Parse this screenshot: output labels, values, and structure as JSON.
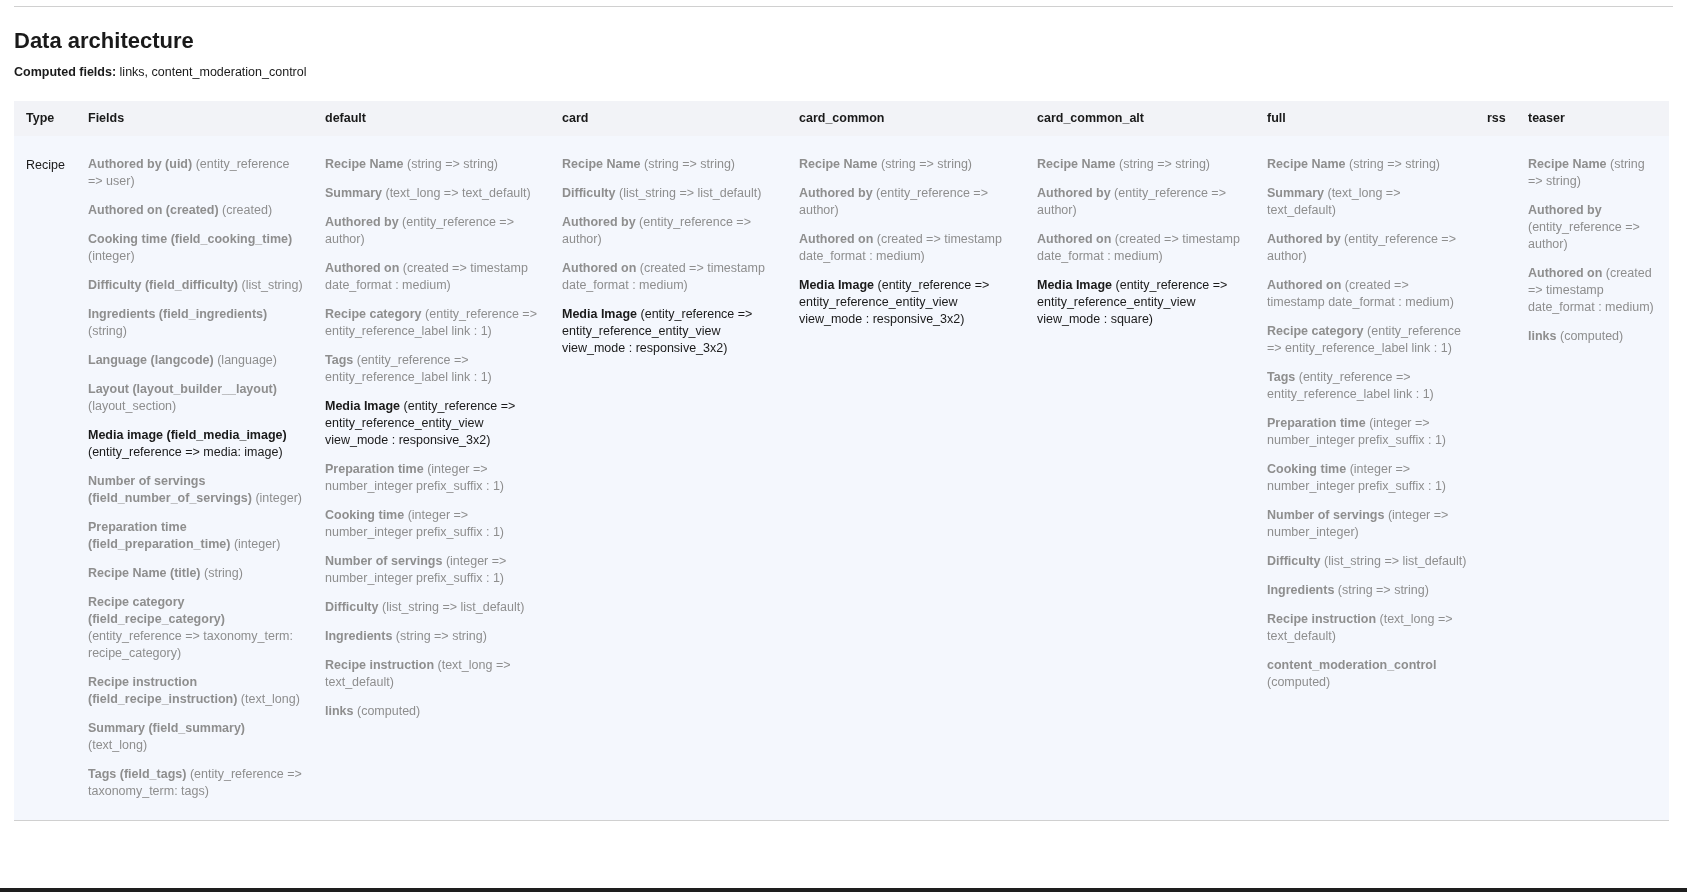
{
  "title": "Data architecture",
  "computed_fields": {
    "label": "Computed fields:",
    "value": "links, content_moderation_control"
  },
  "table": {
    "columns": [
      "Type",
      "Fields",
      "default",
      "card",
      "card_common",
      "card_common_alt",
      "full",
      "rss",
      "teaser"
    ],
    "rows": [
      {
        "cells": [
          {
            "text": "Recipe"
          },
          {
            "items": [
              {
                "label": "Authored by (uid)",
                "detail": "(entity_reference => user)",
                "highlighted": false
              },
              {
                "label": "Authored on (created)",
                "detail": "(created)",
                "highlighted": false
              },
              {
                "label": "Cooking time (field_cooking_time)",
                "detail": "(integer)",
                "highlighted": false
              },
              {
                "label": "Difficulty (field_difficulty)",
                "detail": "(list_string)",
                "highlighted": false
              },
              {
                "label": "Ingredients (field_ingredients)",
                "detail": "(string)",
                "highlighted": false
              },
              {
                "label": "Language (langcode)",
                "detail": "(language)",
                "highlighted": false
              },
              {
                "label": "Layout (layout_builder__layout)",
                "detail": "(layout_section)",
                "highlighted": false
              },
              {
                "label": "Media image (field_media_image)",
                "detail": "(entity_reference => media: image)",
                "highlighted": true
              },
              {
                "label": "Number of servings (field_number_of_servings)",
                "detail": "(integer)",
                "highlighted": false
              },
              {
                "label": "Preparation time (field_preparation_time)",
                "detail": "(integer)",
                "highlighted": false
              },
              {
                "label": "Recipe Name (title)",
                "detail": "(string)",
                "highlighted": false
              },
              {
                "label": "Recipe category (field_recipe_category)",
                "detail": "(entity_reference => taxonomy_term: recipe_category)",
                "highlighted": false
              },
              {
                "label": "Recipe instruction (field_recipe_instruction)",
                "detail": "(text_long)",
                "highlighted": false
              },
              {
                "label": "Summary (field_summary)",
                "detail": "(text_long)",
                "highlighted": false
              },
              {
                "label": "Tags (field_tags)",
                "detail": "(entity_reference => taxonomy_term: tags)",
                "highlighted": false
              }
            ]
          },
          {
            "items": [
              {
                "label": "Recipe Name",
                "detail": "(string => string)",
                "highlighted": false
              },
              {
                "label": "Summary",
                "detail": "(text_long => text_default)",
                "highlighted": false
              },
              {
                "label": "Authored by",
                "detail": "(entity_reference => author)",
                "highlighted": false
              },
              {
                "label": "Authored on",
                "detail": "(created => timestamp date_format : medium)",
                "highlighted": false
              },
              {
                "label": "Recipe category",
                "detail": "(entity_reference => entity_reference_label link : 1)",
                "highlighted": false
              },
              {
                "label": "Tags",
                "detail": "(entity_reference => entity_reference_label link : 1)",
                "highlighted": false
              },
              {
                "label": "Media Image",
                "detail": "(entity_reference => entity_reference_entity_view view_mode : responsive_3x2)",
                "highlighted": true
              },
              {
                "label": "Preparation time",
                "detail": "(integer => number_integer prefix_suffix : 1)",
                "highlighted": false
              },
              {
                "label": "Cooking time",
                "detail": "(integer => number_integer prefix_suffix : 1)",
                "highlighted": false
              },
              {
                "label": "Number of servings",
                "detail": "(integer => number_integer prefix_suffix : 1)",
                "highlighted": false
              },
              {
                "label": "Difficulty",
                "detail": "(list_string => list_default)",
                "highlighted": false
              },
              {
                "label": "Ingredients",
                "detail": "(string => string)",
                "highlighted": false
              },
              {
                "label": "Recipe instruction",
                "detail": "(text_long => text_default)",
                "highlighted": false
              },
              {
                "label": "links",
                "detail": "(computed)",
                "highlighted": false
              }
            ]
          },
          {
            "items": [
              {
                "label": "Recipe Name",
                "detail": "(string => string)",
                "highlighted": false
              },
              {
                "label": "Difficulty",
                "detail": "(list_string => list_default)",
                "highlighted": false
              },
              {
                "label": "Authored by",
                "detail": "(entity_reference => author)",
                "highlighted": false
              },
              {
                "label": "Authored on",
                "detail": "(created => timestamp date_format : medium)",
                "highlighted": false
              },
              {
                "label": "Media Image",
                "detail": "(entity_reference => entity_reference_entity_view view_mode : responsive_3x2)",
                "highlighted": true
              }
            ]
          },
          {
            "items": [
              {
                "label": "Recipe Name",
                "detail": "(string => string)",
                "highlighted": false
              },
              {
                "label": "Authored by",
                "detail": "(entity_reference => author)",
                "highlighted": false
              },
              {
                "label": "Authored on",
                "detail": "(created => timestamp date_format : medium)",
                "highlighted": false
              },
              {
                "label": "Media Image",
                "detail": "(entity_reference => entity_reference_entity_view view_mode : responsive_3x2)",
                "highlighted": true
              }
            ]
          },
          {
            "items": [
              {
                "label": "Recipe Name",
                "detail": "(string => string)",
                "highlighted": false
              },
              {
                "label": "Authored by",
                "detail": "(entity_reference => author)",
                "highlighted": false
              },
              {
                "label": "Authored on",
                "detail": "(created => timestamp date_format : medium)",
                "highlighted": false
              },
              {
                "label": "Media Image",
                "detail": "(entity_reference => entity_reference_entity_view view_mode : square)",
                "highlighted": true
              }
            ]
          },
          {
            "items": [
              {
                "label": "Recipe Name",
                "detail": "(string => string)",
                "highlighted": false
              },
              {
                "label": "Summary",
                "detail": "(text_long => text_default)",
                "highlighted": false
              },
              {
                "label": "Authored by",
                "detail": "(entity_reference => author)",
                "highlighted": false
              },
              {
                "label": "Authored on",
                "detail": "(created => timestamp date_format : medium)",
                "highlighted": false
              },
              {
                "label": "Recipe category",
                "detail": "(entity_reference => entity_reference_label link : 1)",
                "highlighted": false
              },
              {
                "label": "Tags",
                "detail": "(entity_reference => entity_reference_label link : 1)",
                "highlighted": false
              },
              {
                "label": "Preparation time",
                "detail": "(integer => number_integer prefix_suffix : 1)",
                "highlighted": false
              },
              {
                "label": "Cooking time",
                "detail": "(integer => number_integer prefix_suffix : 1)",
                "highlighted": false
              },
              {
                "label": "Number of servings",
                "detail": "(integer => number_integer)",
                "highlighted": false
              },
              {
                "label": "Difficulty",
                "detail": "(list_string => list_default)",
                "highlighted": false
              },
              {
                "label": "Ingredients",
                "detail": "(string => string)",
                "highlighted": false
              },
              {
                "label": "Recipe instruction",
                "detail": "(text_long => text_default)",
                "highlighted": false
              },
              {
                "label": "content_moderation_control",
                "detail": "(computed)",
                "highlighted": false
              }
            ]
          },
          {},
          {
            "items": [
              {
                "label": "Recipe Name",
                "detail": "(string => string)",
                "highlighted": false
              },
              {
                "label": "Authored by",
                "detail": "(entity_reference => author)",
                "highlighted": false
              },
              {
                "label": "Authored on",
                "detail": "(created => timestamp date_format : medium)",
                "highlighted": false
              },
              {
                "label": "links",
                "detail": "(computed)",
                "highlighted": false
              }
            ]
          }
        ]
      }
    ]
  }
}
